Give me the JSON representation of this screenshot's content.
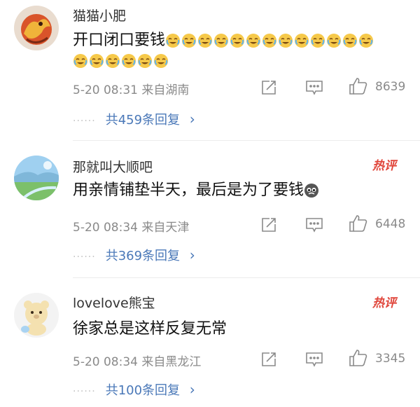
{
  "comments": [
    {
      "user": "猫猫小肥",
      "text": "开口闭口要钱",
      "emoji_name": "laugh-cry-emoji",
      "emoji_count_line1": 13,
      "emoji_count_line2": 6,
      "meta": "5-20 08:31 来自湖南",
      "likes": "8639",
      "replies": "共459条回复",
      "hot_label": ""
    },
    {
      "user": "那就叫大顺吧",
      "text": "用亲情铺垫半天，最后是为了要钱",
      "emoji_name": "crying-face-emoji",
      "meta": "5-20 08:34 来自天津",
      "likes": "6448",
      "replies": "共369条回复",
      "hot_label": "热评"
    },
    {
      "user": "lovelove熊宝",
      "text": "徐家总是这样反复无常",
      "meta": "5-20 08:34 来自黑龙江",
      "likes": "3345",
      "replies": "共100条回复",
      "hot_label": "热评"
    }
  ],
  "icons": {
    "share": "share-icon",
    "comment": "comment-icon",
    "like": "thumbs-up-icon",
    "more_replies": "chevron-right-icon"
  },
  "colors": {
    "reply_link": "#4a78b8",
    "hot_label": "#e0463b",
    "meta": "#8a8a8a"
  },
  "reply_dots": "······",
  "chevron": "›"
}
